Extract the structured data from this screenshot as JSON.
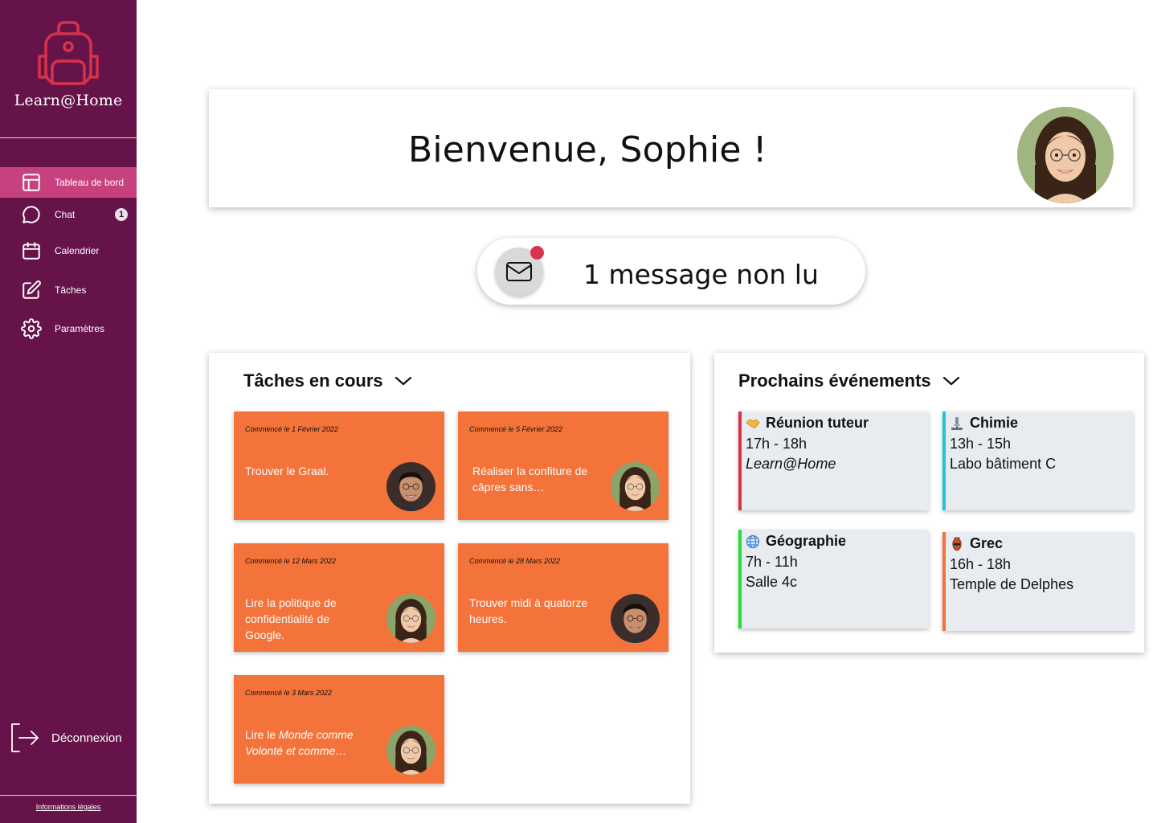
{
  "app": {
    "name": "Learn@Home"
  },
  "sidebar": {
    "items": [
      {
        "label": "Tableau de bord",
        "icon": "dashboard-icon",
        "active": true
      },
      {
        "label": "Chat",
        "icon": "chat-icon",
        "badge": "1"
      },
      {
        "label": "Calendrier",
        "icon": "calendar-icon"
      },
      {
        "label": "Tâches",
        "icon": "edit-icon"
      },
      {
        "label": "Paramètres",
        "icon": "gear-icon"
      }
    ],
    "logout_label": "Déconnexion",
    "legal_label": "Informations légales"
  },
  "welcome": {
    "title": "Bienvenue, Sophie !"
  },
  "messages": {
    "text": "1 message non lu"
  },
  "tasks": {
    "title": "Tâches en cours",
    "items": [
      {
        "date": "Commencé le 1 Février 2022",
        "title": "Trouver le Graal.",
        "owner": "man"
      },
      {
        "date": "Commencé le 5 Février 2022",
        "title": "Réaliser la confiture de câpres sans…",
        "owner": "woman"
      },
      {
        "date": "Commencé le 12 Mars 2022",
        "title": "Lire la politique de confidentialité de Google.",
        "owner": "woman"
      },
      {
        "date": "Commencé le 28 Mars 2022",
        "title": "Trouver midi à quatorze heures.",
        "owner": "man"
      },
      {
        "date": "Commencé le 3 Mars 2022",
        "title_parts": [
          "Lire le ",
          "Monde comme Volonté et comme…"
        ],
        "owner": "woman"
      }
    ]
  },
  "events": {
    "title": "Prochains événements",
    "items": [
      {
        "name": "Réunion tuteur",
        "time": "17h - 18h",
        "place": "Learn@Home",
        "color": "#d6334b",
        "icon": "handshake-icon"
      },
      {
        "name": "Chimie",
        "time": "13h - 15h",
        "place": "Labo bâtiment C",
        "color": "#22c3dd",
        "icon": "microscope-icon"
      },
      {
        "name": "Géographie",
        "time": "7h - 11h",
        "place": "Salle 4c",
        "color": "#22dd3a",
        "icon": "globe-icon"
      },
      {
        "name": "Grec",
        "time": "16h - 18h",
        "place": "Temple de Delphes",
        "color": "#f3733a",
        "icon": "amphora-icon"
      }
    ]
  },
  "colors": {
    "sidebar": "#66134a",
    "active": "#c8417f",
    "task": "#f3733a",
    "event_bg": "#e8ecf0",
    "notif": "#d8344d"
  }
}
